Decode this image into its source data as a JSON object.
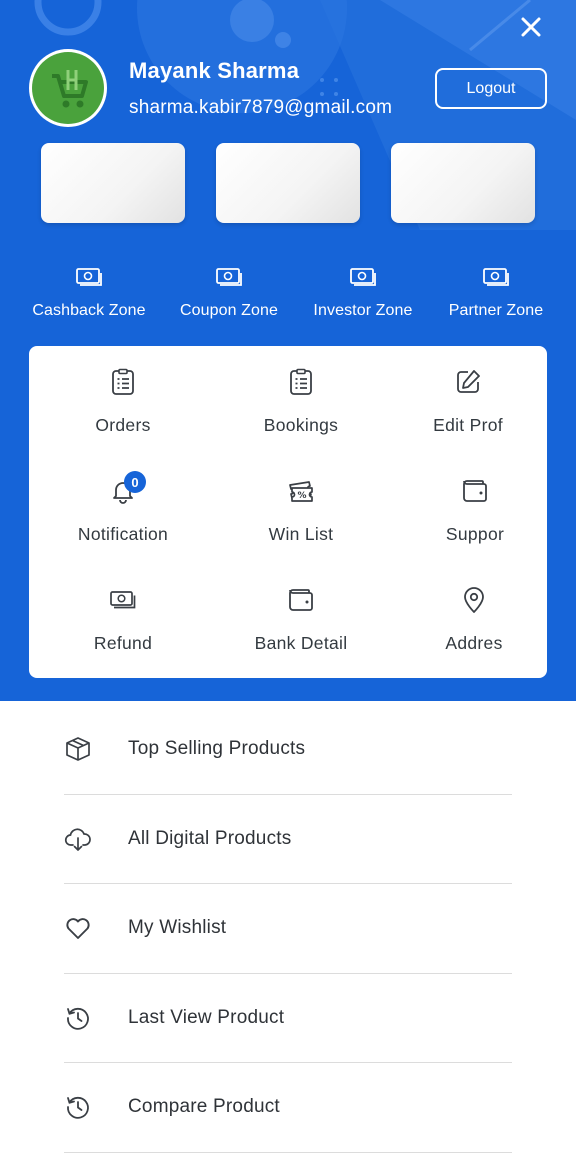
{
  "header": {
    "user_name": "Mayank Sharma",
    "user_email": "sharma.kabir7879@gmail.com",
    "logout_label": "Logout",
    "bg_color": "#1664d8",
    "avatar_color": "#4aa23c"
  },
  "zones": [
    {
      "label": "Cashback Zone",
      "icon": "cash-icon"
    },
    {
      "label": "Coupon Zone",
      "icon": "cash-icon"
    },
    {
      "label": "Investor Zone",
      "icon": "cash-icon"
    },
    {
      "label": "Partner Zone",
      "icon": "cash-icon"
    }
  ],
  "menu_grid": [
    {
      "label": "Orders",
      "icon": "clipboard-list-icon"
    },
    {
      "label": "Bookings",
      "icon": "clipboard-list-icon"
    },
    {
      "label": "Edit Prof",
      "icon": "edit-icon"
    },
    {
      "label": "Notification",
      "icon": "bell-icon",
      "badge": "0"
    },
    {
      "label": "Win List",
      "icon": "ticket-percent-icon"
    },
    {
      "label": "Suppor",
      "icon": "wallet-icon"
    },
    {
      "label": "Refund",
      "icon": "cash-icon"
    },
    {
      "label": "Bank Detail",
      "icon": "wallet-icon"
    },
    {
      "label": "Addres",
      "icon": "map-pin-icon"
    }
  ],
  "list": [
    {
      "label": "Top Selling Products",
      "icon": "box-icon"
    },
    {
      "label": "All Digital Products",
      "icon": "cloud-download-icon"
    },
    {
      "label": "My Wishlist",
      "icon": "heart-icon"
    },
    {
      "label": "Last View Product",
      "icon": "history-icon"
    },
    {
      "label": "Compare Product",
      "icon": "history-icon"
    }
  ]
}
